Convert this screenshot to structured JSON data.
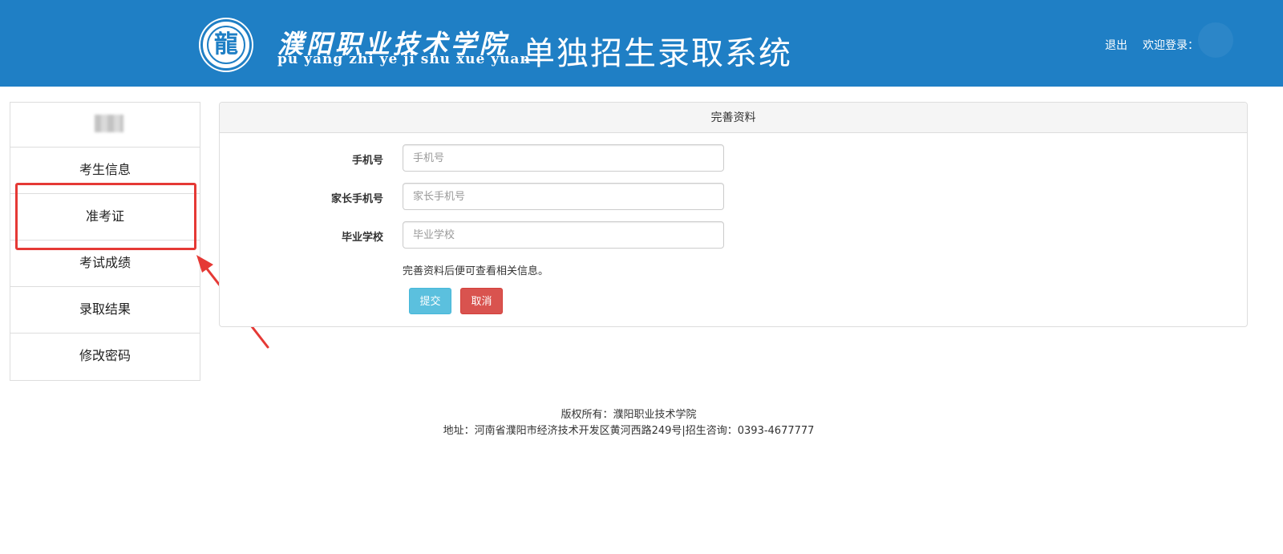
{
  "header": {
    "school_name_cn": "濮阳职业技术学院",
    "school_name_pinyin": "pu yang zhi ye ji shu xue yuan",
    "system_title": "单独招生录取系统",
    "logout_label": "退出",
    "welcome_label": "欢迎登录：",
    "logo_icon": "school-emblem-icon",
    "bg_color": "#1f7fc5"
  },
  "sidebar": {
    "items": [
      {
        "label": "考生信息"
      },
      {
        "label": "准考证"
      },
      {
        "label": "考试成绩"
      },
      {
        "label": "录取结果"
      },
      {
        "label": "修改密码"
      }
    ],
    "highlighted_item": "准考证",
    "annotation_color": "#e53935"
  },
  "panel": {
    "title": "完善资料",
    "fields": [
      {
        "label": "手机号",
        "placeholder": "手机号",
        "value": ""
      },
      {
        "label": "家长手机号",
        "placeholder": "家长手机号",
        "value": ""
      },
      {
        "label": "毕业学校",
        "placeholder": "毕业学校",
        "value": ""
      }
    ],
    "hint": "完善资料后便可查看相关信息。",
    "submit_label": "提交",
    "cancel_label": "取消",
    "submit_color": "#5bc0de",
    "cancel_color": "#d9534f"
  },
  "footer": {
    "copyright": "版权所有：濮阳职业技术学院",
    "address": "地址：河南省濮阳市经济技术开发区黄河西路249号|招生咨询：0393-4677777"
  }
}
